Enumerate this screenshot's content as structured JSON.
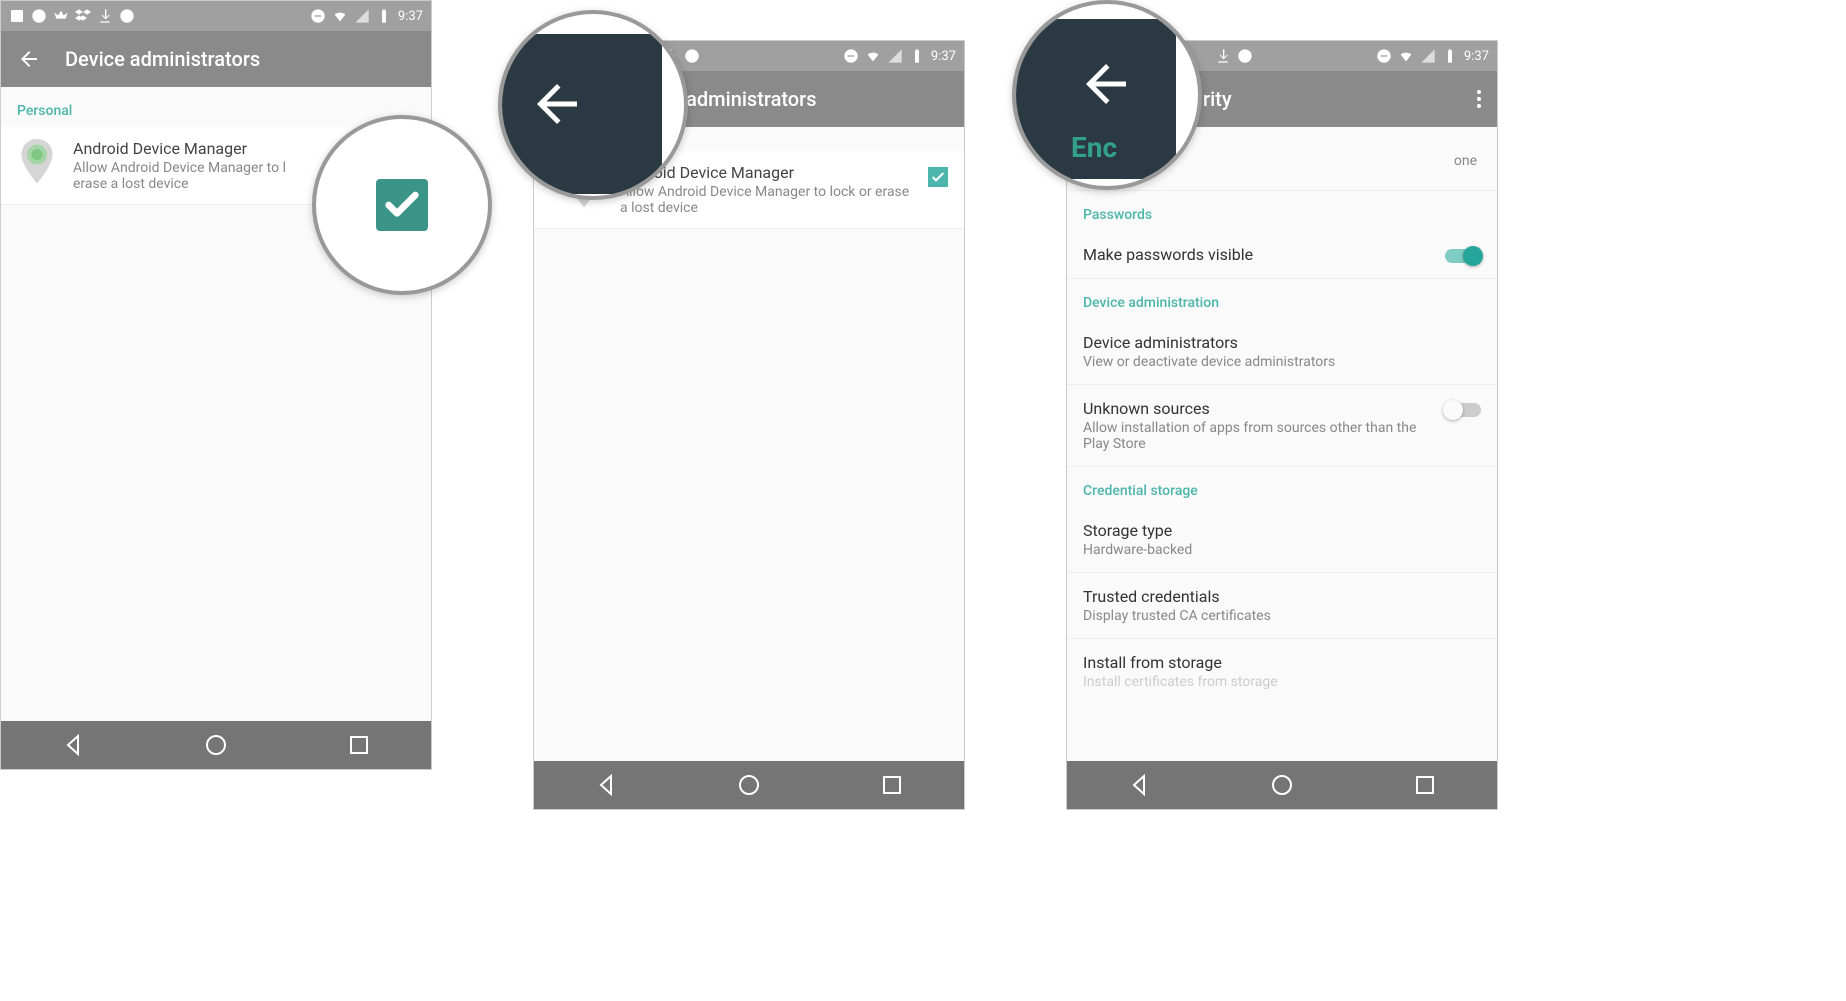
{
  "status": {
    "time": "9:37"
  },
  "screen1": {
    "title": "Device administrators",
    "section": "Personal",
    "item_title": "Android Device Manager",
    "item_sub": "Allow Android Device Manager to lock or erase a lost device",
    "item_sub_clip": "Allow Android Device Manager to l\nerase a lost device"
  },
  "screen2": {
    "title": "ce administrators",
    "item_title": "Android Device Manager",
    "item_sub": "Allow Android Device Manager to lock or erase a lost device"
  },
  "screen3": {
    "title": "rity",
    "enc_partial": "Enc",
    "enc_sub": "one",
    "sections": {
      "passwords": "Passwords",
      "device_admin": "Device administration",
      "cred_storage": "Credential storage"
    },
    "items": {
      "make_pw_visible": "Make passwords visible",
      "device_admins": "Device administrators",
      "device_admins_sub": "View or deactivate device administrators",
      "unknown_src": "Unknown sources",
      "unknown_src_sub": "Allow installation of apps from sources other than the Play Store",
      "storage_type": "Storage type",
      "storage_type_sub": "Hardware-backed",
      "trusted_cred": "Trusted credentials",
      "trusted_cred_sub": "Display trusted CA certificates",
      "install_storage": "Install from storage",
      "install_storage_sub": "Install certificates from storage"
    }
  }
}
